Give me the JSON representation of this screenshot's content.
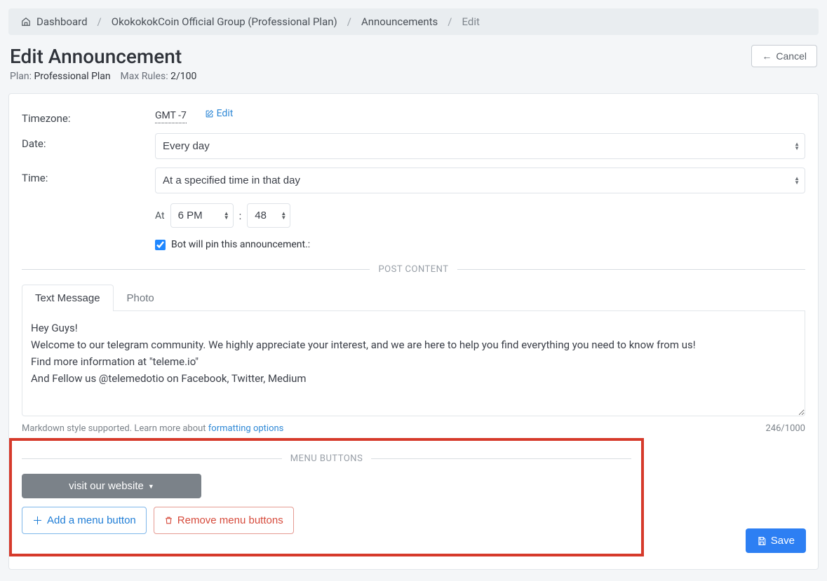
{
  "breadcrumb": {
    "dashboard": "Dashboard",
    "group": "OkokokokCoin Official Group (Professional Plan)",
    "section": "Announcements",
    "current": "Edit"
  },
  "header": {
    "title": "Edit Announcement",
    "plan_label": "Plan: ",
    "plan_value": "Professional Plan",
    "maxrules_label": "Max Rules: ",
    "maxrules_value": "2/100",
    "cancel": "Cancel"
  },
  "form": {
    "tz_label": "Timezone:",
    "tz_value": "GMT -7",
    "tz_edit": "Edit",
    "date_label": "Date:",
    "date_value": "Every day",
    "time_label": "Time:",
    "time_value": "At a specified time in that day",
    "at_label": "At",
    "hour": "6 PM",
    "minute": "48",
    "colon": ":",
    "pin_label": "Bot will pin this announcement.:"
  },
  "post": {
    "section_label": "POST CONTENT",
    "tab_text": "Text Message",
    "tab_photo": "Photo",
    "body": "Hey Guys!\nWelcome to our telegram community. We highly appreciate your interest, and we are here to help you find everything you need to know from us!\nFind more information at \"teleme.io\"\nAnd Fellow us @telemedotio on Facebook, Twitter, Medium",
    "help_text": "Markdown style supported. Learn more about ",
    "help_link": "formatting options",
    "counter": "246/1000"
  },
  "menu": {
    "section_label": "MENU BUTTONS",
    "visit_label": "visit our website",
    "add_label": "Add a menu button",
    "remove_label": "Remove menu buttons"
  },
  "save": {
    "label": "Save"
  }
}
